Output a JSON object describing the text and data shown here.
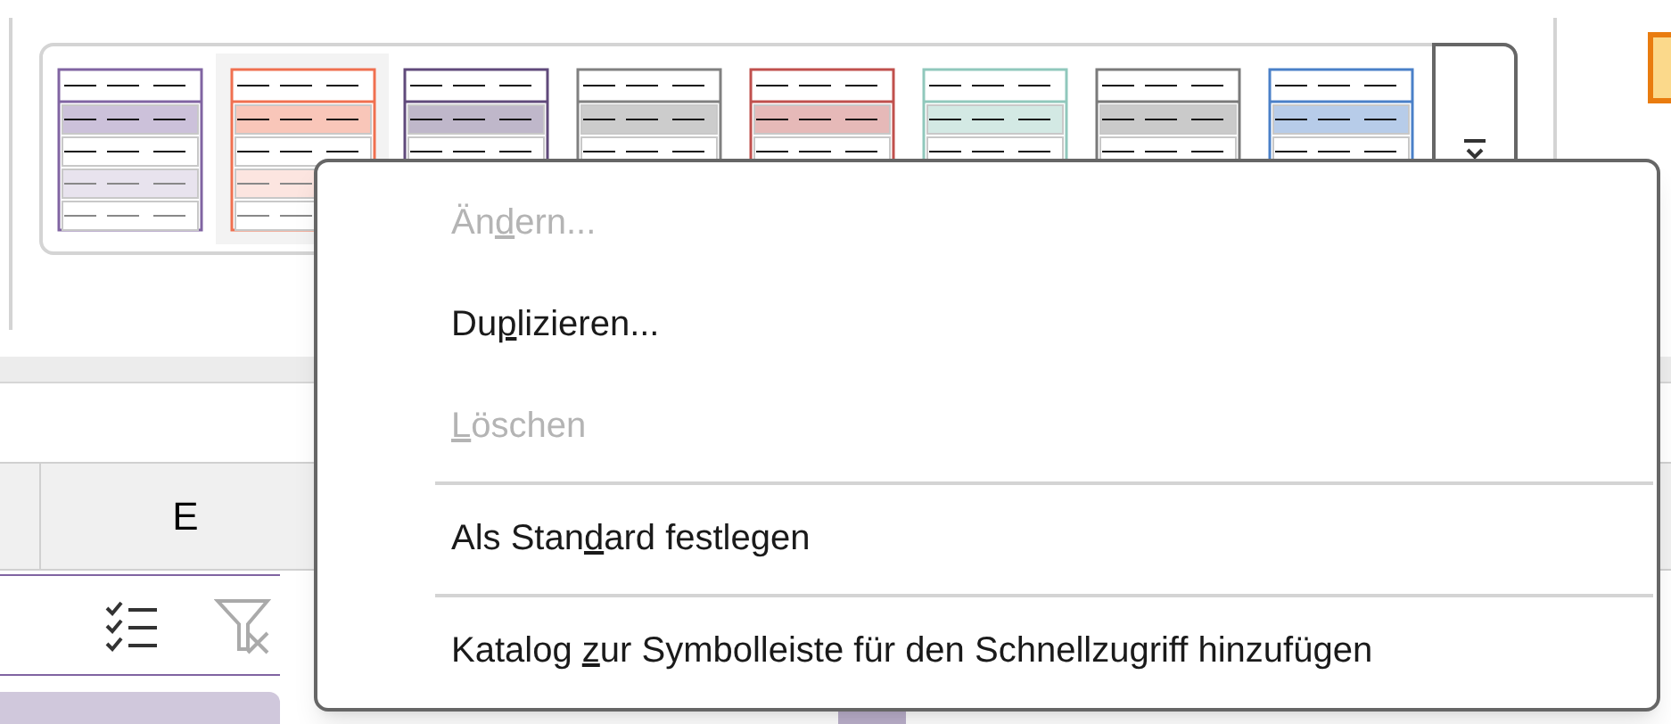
{
  "table_styles": [
    {
      "color": "#8064a2",
      "selected": false
    },
    {
      "color": "#f07050",
      "selected": true
    },
    {
      "color": "#604a7b",
      "selected": false
    },
    {
      "color": "#808080",
      "selected": false
    },
    {
      "color": "#c0504d",
      "selected": false
    },
    {
      "color": "#90c8bc",
      "selected": false
    },
    {
      "color": "#7a7a7a",
      "selected": false
    },
    {
      "color": "#4a80c8",
      "selected": false
    }
  ],
  "sheet": {
    "column_headers": [
      "E"
    ]
  },
  "context_menu": {
    "items": [
      {
        "kind": "item",
        "before": "Än",
        "access_key": "d",
        "after": "ern...",
        "disabled": true
      },
      {
        "kind": "item",
        "before": "Du",
        "access_key": "p",
        "after": "lizieren...",
        "disabled": false
      },
      {
        "kind": "item",
        "access_key": "L",
        "after": "öschen",
        "disabled": true
      },
      {
        "kind": "separator"
      },
      {
        "kind": "item",
        "before": "Als Stan",
        "access_key": "d",
        "after": "ard festlegen",
        "disabled": false
      },
      {
        "kind": "separator"
      },
      {
        "kind": "item",
        "before": "Katalog ",
        "access_key": "z",
        "after": "ur Symbolleiste für den Schnellzugriff hinzufügen",
        "disabled": false
      }
    ]
  }
}
